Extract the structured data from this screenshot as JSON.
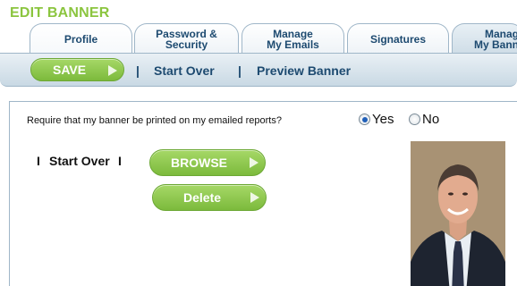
{
  "page": {
    "heading": "EDIT BANNER"
  },
  "tabs": [
    {
      "line1": "Profile",
      "line2": ""
    },
    {
      "line1": "Password &",
      "line2": "Security"
    },
    {
      "line1": "Manage",
      "line2": "My Emails"
    },
    {
      "line1": "Signatures",
      "line2": ""
    },
    {
      "line1": "Manag",
      "line2": "My Bann"
    }
  ],
  "toolbar": {
    "save_label": "SAVE",
    "separator": "|",
    "start_over_label": "Start Over",
    "preview_label": "Preview Banner"
  },
  "content": {
    "require_label": "Require that my banner be printed on my emailed reports?",
    "yes_label": "Yes",
    "no_label": "No",
    "selected": "Yes",
    "start_over_label": "Start Over",
    "separator": "I",
    "browse_label": "BROWSE",
    "delete_label": "Delete"
  },
  "colors": {
    "accent_green": "#8bc53f",
    "button_green": "#7cba3c",
    "link_blue": "#1d4a70"
  },
  "icons": {
    "button_arrow": "triangle-right-icon"
  }
}
